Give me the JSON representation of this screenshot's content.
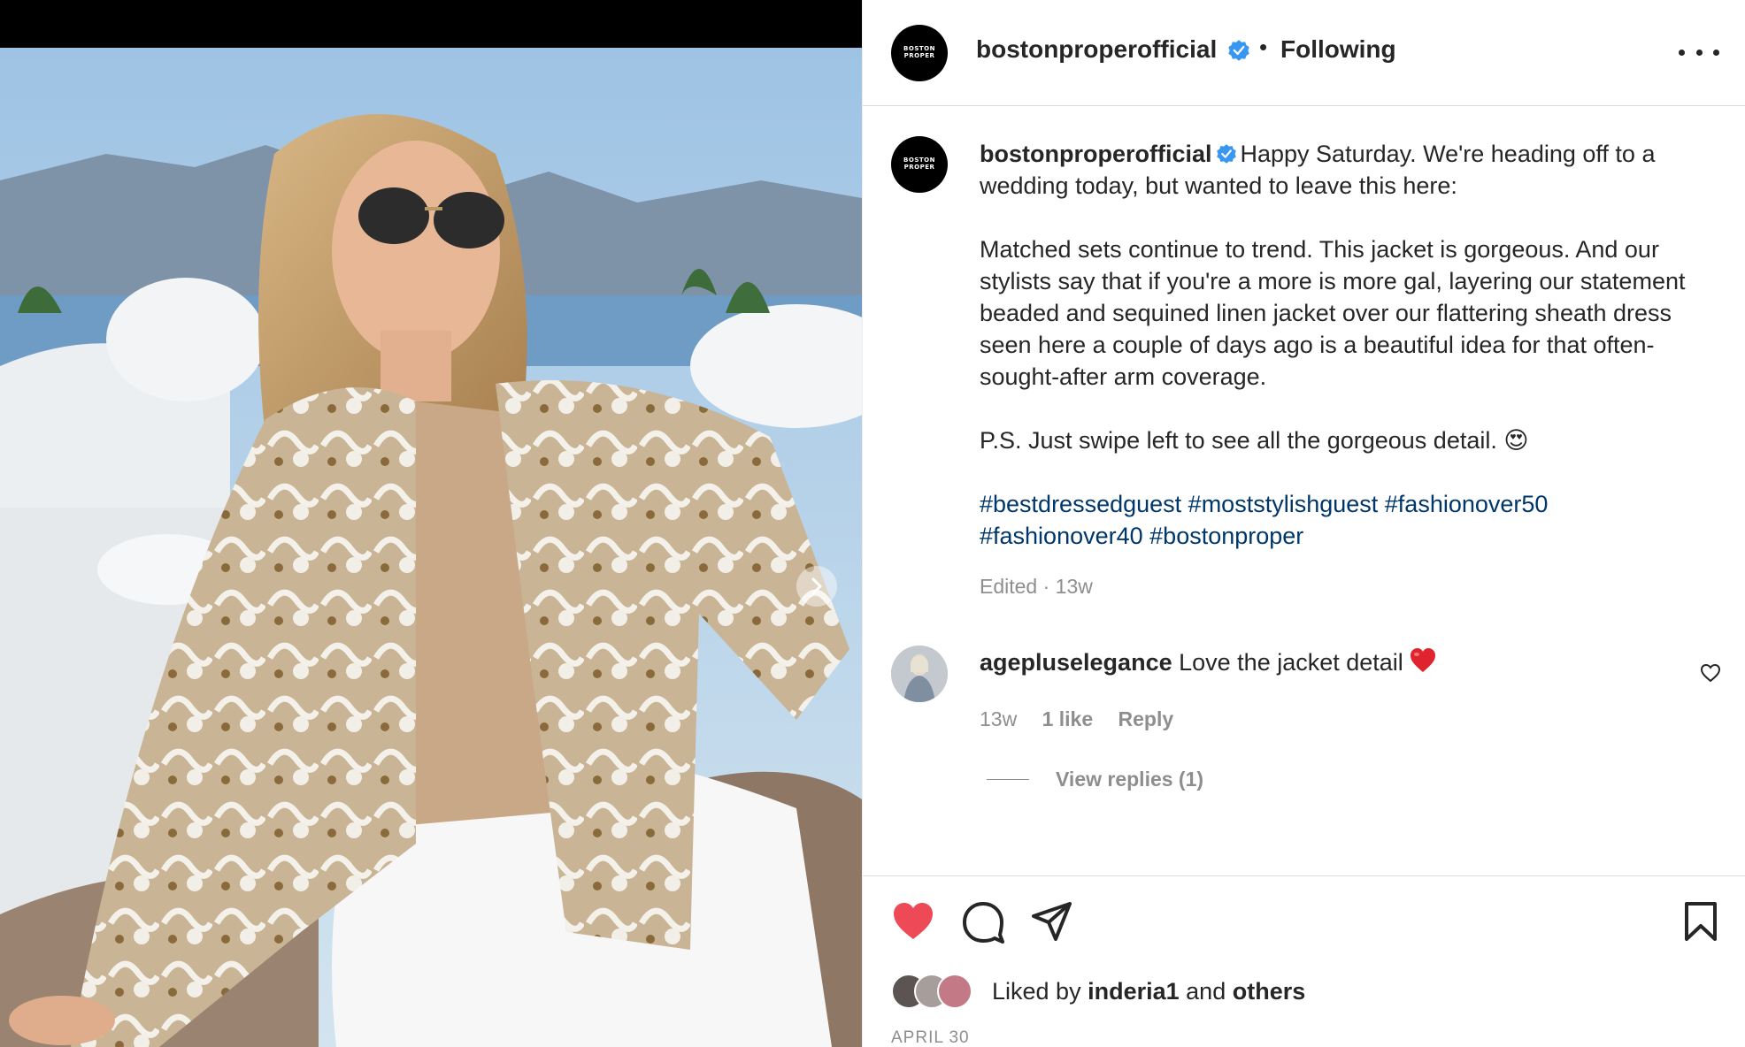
{
  "post": {
    "username": "bostonproperofficial",
    "avatar_text": [
      "BOSTON",
      "PROPER"
    ],
    "following_label": "Following",
    "separator": "•"
  },
  "caption": {
    "username": "bostonproperofficial",
    "paragraph1": "Happy Saturday. We're heading off to a wedding today, but wanted to leave this here:",
    "paragraph2": "Matched sets continue to trend. This jacket is gorgeous. And our stylists say that if you're a more is more gal, layering our statement beaded and sequined linen jacket over our flattering sheath dress seen here a couple of days ago is a beautiful idea for that often-sought-after arm coverage.",
    "paragraph3": "P.S. Just swipe left to see all the gorgeous detail.",
    "paragraph3_emoji": "😍",
    "hashtags": [
      "#bestdressedguest",
      "#moststylishguest",
      "#fashionover50",
      "#fashionover40",
      "#bostonproper"
    ],
    "meta": "Edited · 13w"
  },
  "comment": {
    "username": "agepluselegance",
    "text": "Love the jacket detail",
    "time": "13w",
    "likes": "1 like",
    "reply_label": "Reply",
    "view_replies": "View replies (1)"
  },
  "likes": {
    "prefix": "Liked by",
    "user": "inderia1",
    "joiner": "and",
    "others": "others"
  },
  "date": "APRIL 30",
  "icons": {
    "verified": "verified-badge-icon",
    "more": "more-options-icon",
    "like": "heart-filled-icon",
    "comment": "comment-bubble-icon",
    "share": "paper-plane-icon",
    "save": "bookmark-icon",
    "next": "chevron-right-icon"
  },
  "colors": {
    "like_red": "#ed4956",
    "verified_blue": "#3897f0",
    "hashtag": "#00376b",
    "muted": "#8e8e8e",
    "text": "#262626"
  }
}
